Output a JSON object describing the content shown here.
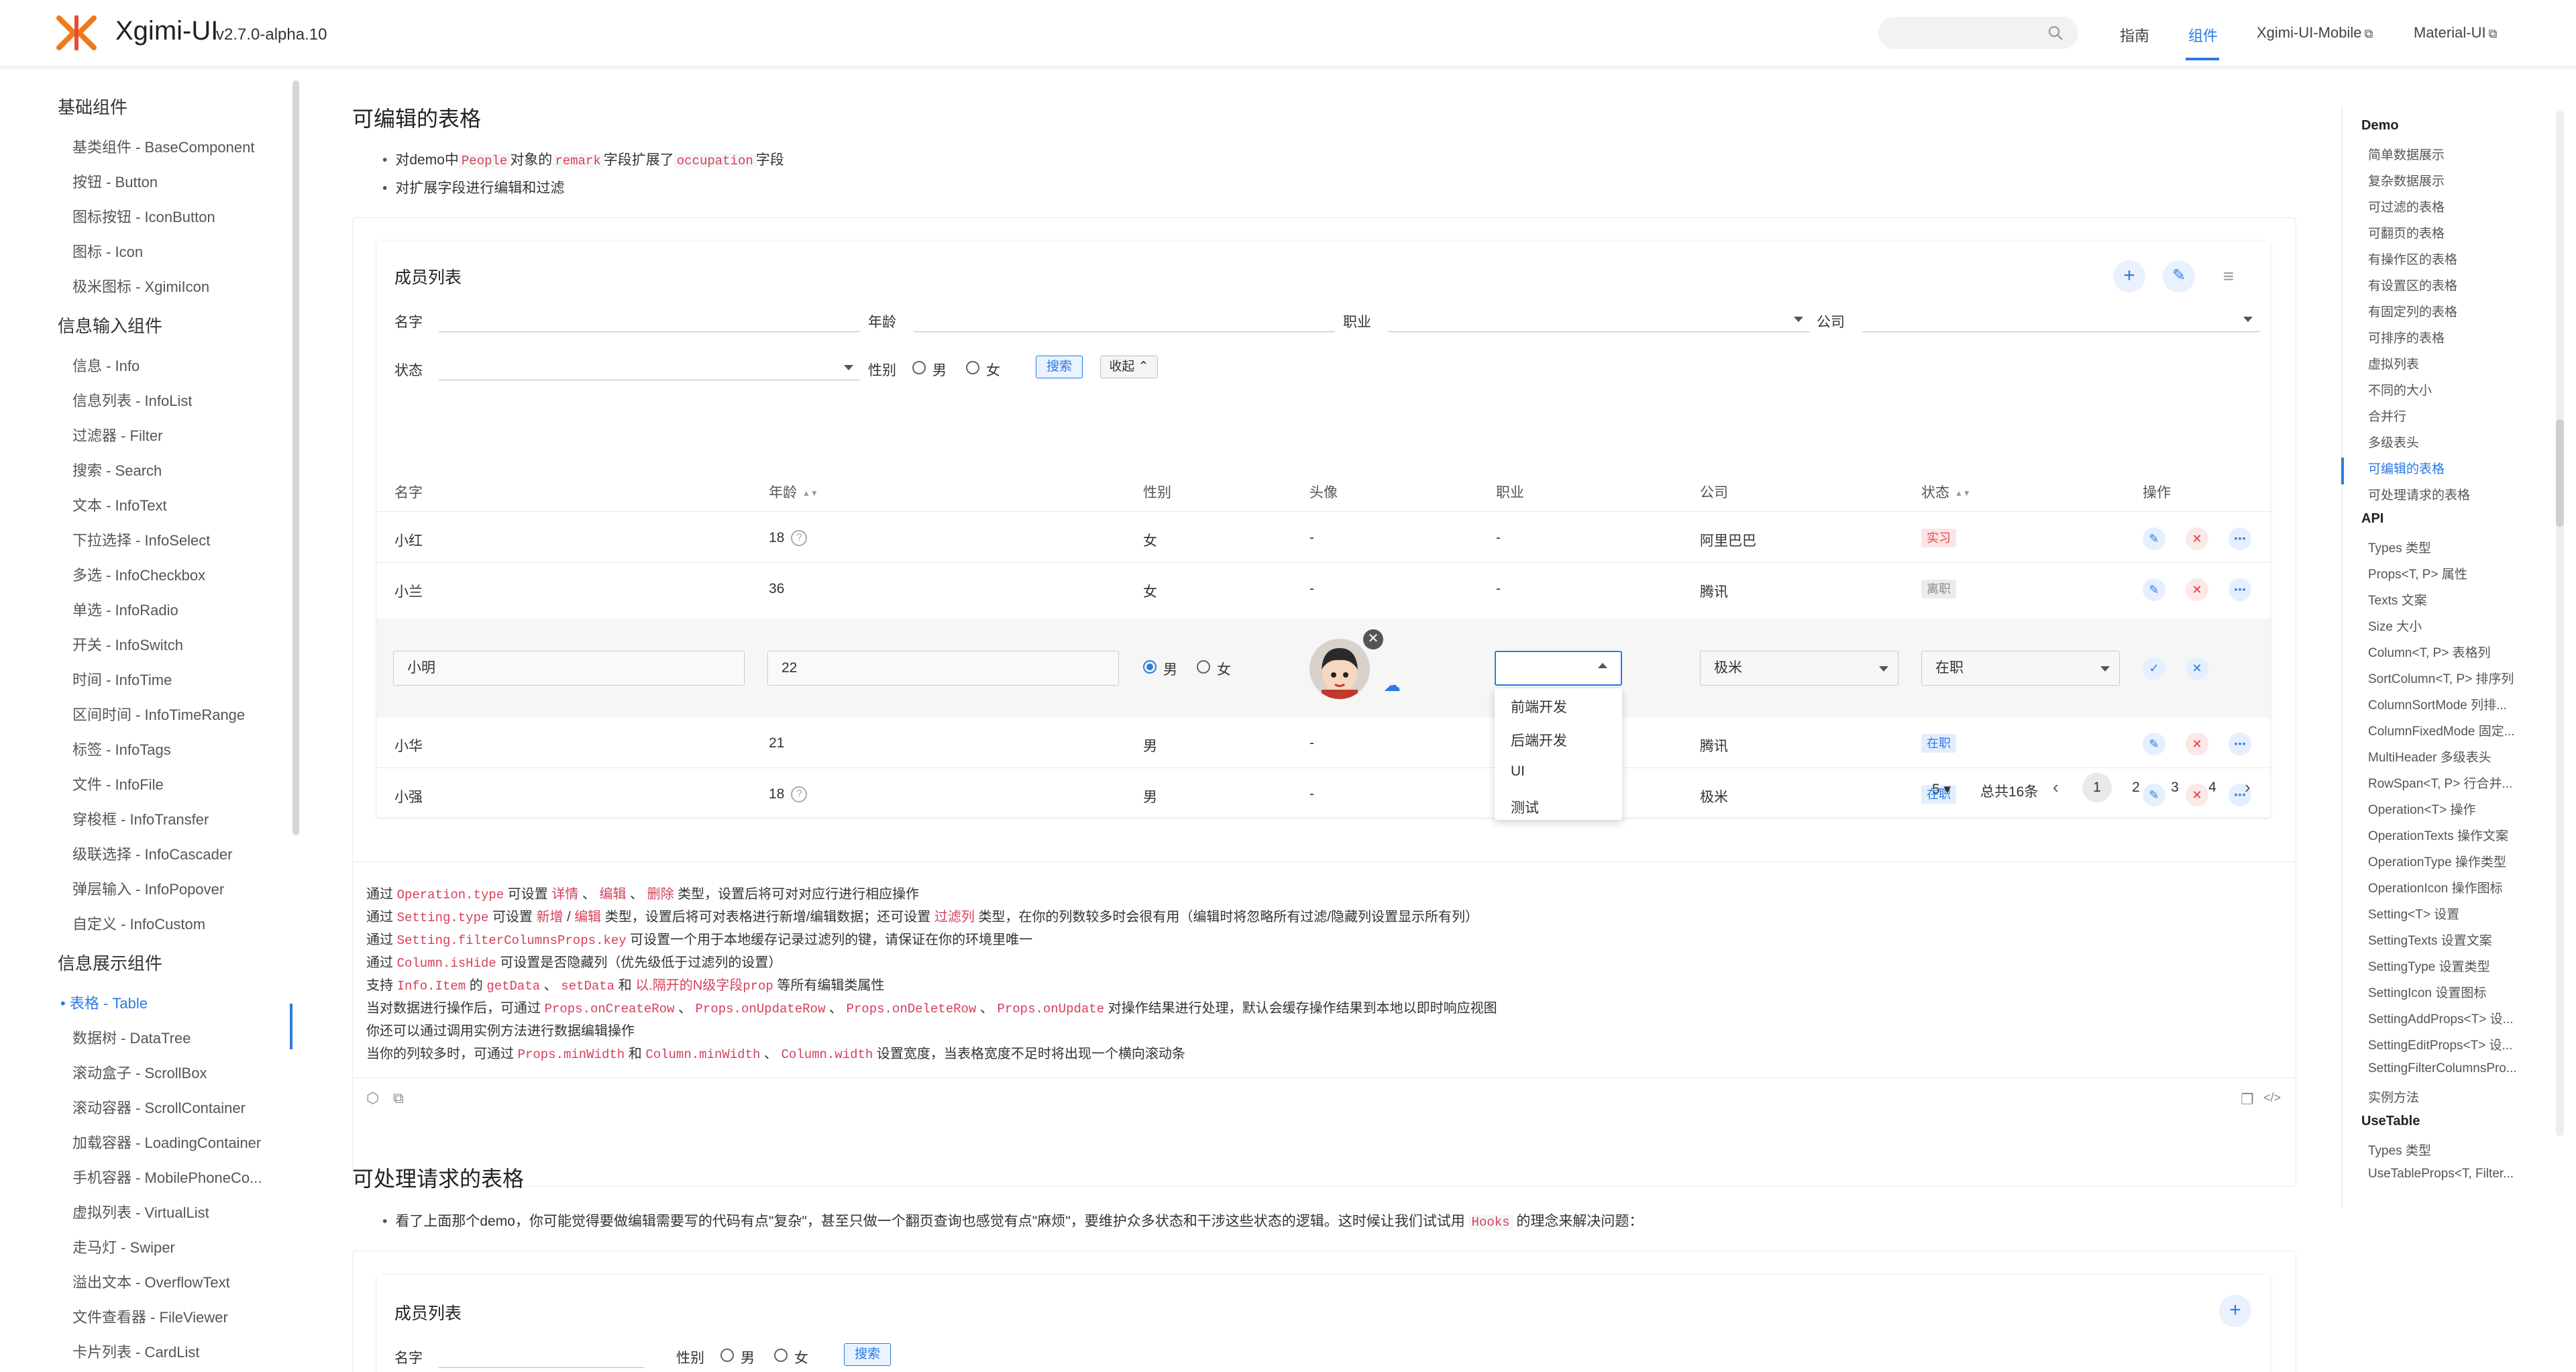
{
  "header": {
    "brand": "Xgimi-UI",
    "version": "v2.7.0-alpha.10",
    "nav": [
      {
        "label": "指南",
        "external": false
      },
      {
        "label": "组件",
        "external": false,
        "active": true
      },
      {
        "label": "Xgimi-UI-Mobile",
        "external": true
      },
      {
        "label": "Material-UI",
        "external": true
      }
    ],
    "ext_glyph": "⧉"
  },
  "sidebar": {
    "groups": [
      {
        "title": "基础组件",
        "items": [
          "基类组件 - BaseComponent",
          "按钮 - Button",
          "图标按钮 - IconButton",
          "图标 - Icon",
          "极米图标 - XgimiIcon"
        ]
      },
      {
        "title": "信息输入组件",
        "items": [
          "信息 - Info",
          "信息列表 - InfoList",
          "过滤器 - Filter",
          "搜索 - Search",
          "文本 - InfoText",
          "下拉选择 - InfoSelect",
          "多选 - InfoCheckbox",
          "单选 - InfoRadio",
          "开关 - InfoSwitch",
          "时间 - InfoTime",
          "区间时间 - InfoTimeRange",
          "标签 - InfoTags",
          "文件 - InfoFile",
          "穿梭框 - InfoTransfer",
          "级联选择 - InfoCascader",
          "弹层输入 - InfoPopover",
          "自定义 - InfoCustom"
        ]
      },
      {
        "title": "信息展示组件",
        "items": [
          "• 表格 - Table",
          "数据树 - DataTree",
          "滚动盒子 - ScrollBox",
          "滚动容器 - ScrollContainer",
          "加载容器 - LoadingContainer",
          "手机容器 - MobilePhoneCo...",
          "虚拟列表 - VirtualList",
          "走马灯 - Swiper",
          "溢出文本 - OverflowText",
          "文件查看器 - FileViewer",
          "卡片列表 - CardList"
        ]
      }
    ]
  },
  "section1": {
    "title": "可编辑的表格",
    "bullet1": {
      "pre": "对demo中",
      "c1": "People",
      "mid1": "对象的",
      "c2": "remark",
      "mid2": "字段扩展了",
      "c3": "occupation",
      "post": "字段"
    },
    "bullet2": "对扩展字段进行编辑和过滤"
  },
  "table_card": {
    "title": "成员列表",
    "add_glyph": "+",
    "edit_glyph": "✎",
    "filter_glyph": "≡",
    "filters": {
      "name_label": "名字",
      "age_label": "年龄",
      "job_label": "职业",
      "company_label": "公司",
      "status_label": "状态",
      "gender_label": "性别",
      "male": "男",
      "female": "女",
      "search_btn": "搜索",
      "collapse_btn": "收起 ⌃"
    },
    "columns": [
      "名字",
      "年龄",
      "性别",
      "头像",
      "职业",
      "公司",
      "状态",
      "操作"
    ],
    "sort_glyph": "▲▼",
    "help_glyph": "?",
    "rows": [
      {
        "name": "小红",
        "age": "18",
        "help": true,
        "gender": "女",
        "avatar": "-",
        "job": "-",
        "company": "阿里巴巴",
        "status": "实习",
        "status_type": "intern"
      },
      {
        "name": "小兰",
        "age": "36",
        "help": false,
        "gender": "女",
        "avatar": "-",
        "job": "-",
        "company": "腾讯",
        "status": "离职",
        "status_type": "left"
      },
      {
        "name": "小华",
        "age": "21",
        "help": false,
        "gender": "男",
        "avatar": "-",
        "job": "",
        "company": "腾讯",
        "status": "在职",
        "status_type": "active"
      },
      {
        "name": "小强",
        "age": "18",
        "help": true,
        "gender": "男",
        "avatar": "-",
        "job": "",
        "company": "极米",
        "status": "在职",
        "status_type": "active"
      }
    ],
    "edit_row": {
      "name": "小明",
      "age": "22",
      "male": "男",
      "female": "女",
      "company": "极米",
      "status": "在职",
      "job_options": [
        "前端开发",
        "后端开发",
        "UI",
        "测试"
      ]
    },
    "actions": {
      "edit": "✎",
      "delete": "✕",
      "more": "⋯",
      "confirm": "✓",
      "cancel": "✕",
      "close": "✕",
      "upload": "☁"
    },
    "pagination": {
      "page_size": "5 ▾",
      "total": "总共16条",
      "pages": [
        "1",
        "2",
        "3",
        "4"
      ],
      "current": "1",
      "prev": "‹",
      "next": "›"
    }
  },
  "description": {
    "l1": {
      "a": "通过 ",
      "c1": "Operation.type",
      "b": " 可设置 ",
      "r1": "详情",
      "s1": " 、 ",
      "r2": "编辑",
      "s2": " 、 ",
      "r3": "删除",
      "c": " 类型，设置后将可对对应行进行相应操作"
    },
    "l2": {
      "a": "通过 ",
      "c1": "Setting.type",
      "b": " 可设置 ",
      "r1": "新增",
      "s1": " / ",
      "r2": "编辑",
      "c": " 类型，设置后将可对表格进行新增/编辑数据；还可设置 ",
      "r3": "过滤列",
      "d": " 类型，在你的列数较多时会很有用（编辑时将忽略所有过滤/隐藏列设置显示所有列）"
    },
    "l3": {
      "a": "通过 ",
      "c1": "Setting.filterColumnsProps.key",
      "b": " 可设置一个用于本地缓存记录过滤列的键，请保证在你的环境里唯一"
    },
    "l4": {
      "a": "通过 ",
      "c1": "Column.isHide",
      "b": " 可设置是否隐藏列（优先级低于过滤列的设置）"
    },
    "l5": {
      "a": "支持 ",
      "c1": "Info.Item",
      "b": " 的 ",
      "c2": "getData",
      "s1": " 、 ",
      "c3": "setData",
      "c": " 和 ",
      "r1": "以.隔开的N级字段",
      "c4": "prop",
      "d": " 等所有编辑类属性"
    },
    "l6": {
      "a": "当对数据进行操作后，可通过 ",
      "c1": "Props.onCreateRow",
      "s1": " 、 ",
      "c2": "Props.onUpdateRow",
      "s2": " 、 ",
      "c3": "Props.onDeleteRow",
      "s3": " 、 ",
      "c4": "Props.onUpdate",
      "b": " 对操作结果进行处理，默认会缓存操作结果到本地以即时响应视图"
    },
    "l7": "你还可以通过调用实例方法进行数据编辑操作",
    "l8": {
      "a": "当你的列较多时，可通过 ",
      "c1": "Props.minWidth",
      "b": " 和 ",
      "c2": "Column.minWidth",
      "s1": " 、 ",
      "c3": "Column.width",
      "c": " 设置宽度，当表格宽度不足时将出现一个横向滚动条"
    }
  },
  "tools": {
    "codesandbox": "⬡",
    "open": "⧉",
    "copy": "❐",
    "code": "</>"
  },
  "section2": {
    "title": "可处理请求的表格",
    "bullet": {
      "pre": "看了上面那个demo，你可能觉得要做编辑需要写的代码有点\"复杂\"，甚至只做一个翻页查询也感觉有点\"麻烦\"，要维护众多状态和干涉这些状态的逻辑。这时候让我们试试用 ",
      "c1": "Hooks",
      "post": " 的理念来解决问题："
    },
    "card_title": "成员列表",
    "name_label": "名字",
    "gender_label": "性别",
    "male": "男",
    "female": "女",
    "search_btn": "搜索"
  },
  "toc": {
    "groups": [
      {
        "title": "Demo",
        "items": [
          "简单数据展示",
          "复杂数据展示",
          "可过滤的表格",
          "可翻页的表格",
          "有操作区的表格",
          "有设置区的表格",
          "有固定列的表格",
          "可排序的表格",
          "虚拟列表",
          "不同的大小",
          "合并行",
          "多级表头",
          "可编辑的表格",
          "可处理请求的表格"
        ]
      },
      {
        "title": "API",
        "items": [
          "Types 类型",
          "Props<T, P> 属性",
          "Texts 文案",
          "Size 大小",
          "Column<T, P> 表格列",
          "SortColumn<T, P> 排序列",
          "ColumnSortMode 列排...",
          "ColumnFixedMode 固定...",
          "MultiHeader 多级表头",
          "RowSpan<T, P> 行合并...",
          "Operation<T> 操作",
          "OperationTexts 操作文案",
          "OperationType 操作类型",
          "OperationIcon 操作图标",
          "Setting<T> 设置",
          "SettingTexts 设置文案",
          "SettingType 设置类型",
          "SettingIcon 设置图标",
          "SettingAddProps<T> 设...",
          "SettingEditProps<T> 设...",
          "SettingFilterColumnsPro...",
          "实例方法"
        ]
      },
      {
        "title": "UseTable",
        "items": [
          "Types 类型",
          "UseTableProps<T, Filter..."
        ]
      }
    ],
    "active": "可编辑的表格"
  },
  "colors": {
    "accent": "#2a7be4",
    "danger": "#e03a3a",
    "code": "#d6405a"
  }
}
